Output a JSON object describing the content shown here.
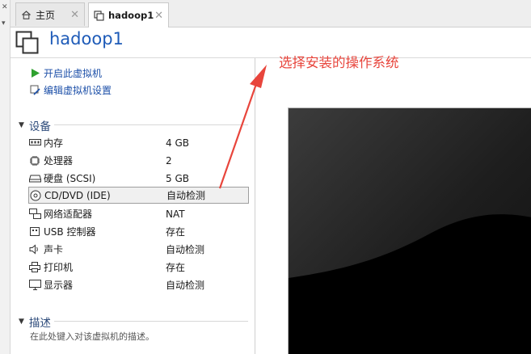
{
  "tabs": [
    {
      "label": "主页",
      "icon": "home-icon"
    },
    {
      "label": "hadoop1",
      "icon": "vm-tab-icon"
    }
  ],
  "header": {
    "title": "hadoop1"
  },
  "actions": [
    {
      "label": "开启此虚拟机",
      "icon": "play-icon"
    },
    {
      "label": "编辑虚拟机设置",
      "icon": "edit-settings-icon"
    }
  ],
  "devices_section": {
    "title": "设备"
  },
  "devices": [
    {
      "name": "内存",
      "value": "4 GB",
      "icon": "memory-icon"
    },
    {
      "name": "处理器",
      "value": "2",
      "icon": "cpu-icon"
    },
    {
      "name": "硬盘 (SCSI)",
      "value": "5 GB",
      "icon": "hard-disk-icon"
    },
    {
      "name": "CD/DVD (IDE)",
      "value": "自动检测",
      "icon": "cd-dvd-icon"
    },
    {
      "name": "网络适配器",
      "value": "NAT",
      "icon": "network-adapter-icon"
    },
    {
      "name": "USB 控制器",
      "value": "存在",
      "icon": "usb-icon"
    },
    {
      "name": "声卡",
      "value": "自动检测",
      "icon": "sound-card-icon"
    },
    {
      "name": "打印机",
      "value": "存在",
      "icon": "printer-icon"
    },
    {
      "name": "显示器",
      "value": "自动检测",
      "icon": "display-icon"
    }
  ],
  "description_section": {
    "title": "描述",
    "placeholder": "在此处键入对该虚拟机的描述。"
  },
  "annotation": {
    "text": "选择安装的操作系统",
    "color": "#e8453c"
  },
  "colors": {
    "accent": "#1e5bb8",
    "play_green": "#2ea12e",
    "screen": "#000000"
  }
}
